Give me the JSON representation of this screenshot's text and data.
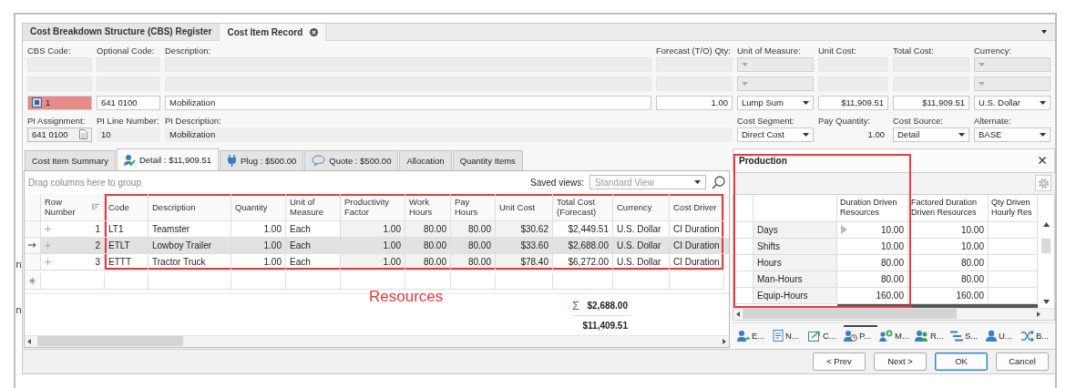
{
  "background_text": [
    "n",
    "n"
  ],
  "document_tabs": [
    {
      "label": "Cost Breakdown Structure (CBS) Register",
      "selected": false,
      "closable": false
    },
    {
      "label": "Cost Item Record",
      "selected": true,
      "closable": true
    }
  ],
  "header_fields": [
    {
      "label": "CBS Code:",
      "kind": "code",
      "value": "1",
      "invalid": true
    },
    {
      "label": "Optional Code:",
      "kind": "text",
      "value": "641 0100"
    },
    {
      "label": "Description:",
      "kind": "text",
      "value": "Mobilization"
    },
    {
      "label": "Forecast (T/O) Qty:",
      "kind": "number",
      "value": "1.00"
    },
    {
      "label": "Unit of Measure:",
      "kind": "dropdown",
      "value": "Lump Sum"
    },
    {
      "label": "Unit Cost:",
      "kind": "number",
      "value": "$11,909.51"
    },
    {
      "label": "Total Cost:",
      "kind": "number",
      "value": "$11,909.51"
    },
    {
      "label": "Currency:",
      "kind": "dropdown",
      "value": "U.S. Dollar"
    }
  ],
  "detail_fields": [
    {
      "label": "PI Assignment:",
      "kind": "lookup",
      "value": "641 0100"
    },
    {
      "label": "PI Line Number:",
      "kind": "readonly",
      "value": "10"
    },
    {
      "label": "PI Description:",
      "kind": "readonly_wide",
      "value": "Mobilization"
    },
    {
      "label": "Cost Segment:",
      "kind": "dropdown",
      "value": "Direct Cost"
    },
    {
      "label": "Pay Quantity:",
      "kind": "plain",
      "value": "1.00"
    },
    {
      "label": "Cost Source:",
      "kind": "dropdown",
      "value": "Detail"
    },
    {
      "label": "Alternate:",
      "kind": "dropdown",
      "value": "BASE"
    }
  ],
  "detail_tabs": [
    {
      "label": "Cost Item Summary",
      "kind": "plain",
      "selected": false
    },
    {
      "label": "Detail : $11,909.51",
      "kind": "detail",
      "selected": true
    },
    {
      "label": "Plug : $500.00",
      "kind": "plug",
      "selected": false
    },
    {
      "label": "Quote : $500.00",
      "kind": "quote",
      "selected": false
    },
    {
      "label": "Allocation",
      "kind": "plain",
      "selected": false
    },
    {
      "label": "Quantity Items",
      "kind": "plain",
      "selected": false
    }
  ],
  "detail_grid": {
    "group_hint": "Drag columns here to group",
    "saved_views_label": "Saved views:",
    "saved_views_placeholder": "Standard View",
    "columns": [
      "Row Number",
      "Code",
      "Description",
      "Quantity",
      "Unit of Measure",
      "Productivity Factor",
      "Work Hours",
      "Pay Hours",
      "Unit Cost",
      "Total Cost (Forecast)",
      "Currency",
      "Cost Driver"
    ],
    "rows": [
      {
        "selected": false,
        "cells": [
          "1",
          "LT1",
          "Teamster",
          "1.00",
          "Each",
          "1.00",
          "80.00",
          "80.00",
          "$30.62",
          "$2,449.51",
          "U.S. Dollar",
          "CI Duration"
        ]
      },
      {
        "selected": true,
        "cells": [
          "2",
          "ETLT",
          "Lowboy Trailer",
          "1.00",
          "Each",
          "1.00",
          "80.00",
          "80.00",
          "$33.60",
          "$2,688.00",
          "U.S. Dollar",
          "CI Duration"
        ]
      },
      {
        "selected": false,
        "cells": [
          "3",
          "ETTT",
          "Tractor Truck",
          "1.00",
          "Each",
          "1.00",
          "80.00",
          "80.00",
          "$78.40",
          "$6,272.00",
          "U.S. Dollar",
          "CI Duration"
        ]
      }
    ],
    "sum_symbol": "Σ",
    "sum": "$2,688.00",
    "total": "$11,409.51",
    "annotation": {
      "outlined": true,
      "label": "Resources"
    }
  },
  "production": {
    "title": "Production",
    "columns": [
      "Duration Driven Resources",
      "Factored Duration Driven Resources",
      "Qty Driven Hourly Res"
    ],
    "rows": [
      {
        "label": "Days",
        "values": [
          "10.00",
          "10.00"
        ],
        "selected": true
      },
      {
        "label": "Shifts",
        "values": [
          "10.00",
          "10.00"
        ],
        "selected": false
      },
      {
        "label": "Hours",
        "values": [
          "80.00",
          "80.00"
        ],
        "selected": false
      },
      {
        "label": "Man-Hours",
        "values": [
          "80.00",
          "80.00"
        ],
        "selected": false
      },
      {
        "label": "Equip-Hours",
        "values": [
          "160.00",
          "160.00"
        ],
        "selected": false
      }
    ],
    "annotation": {
      "outlined": true
    }
  },
  "panel_tabs": [
    {
      "label": "E...",
      "kind": "estimate",
      "selected": false
    },
    {
      "label": "N...",
      "kind": "notes",
      "selected": false
    },
    {
      "label": "C...",
      "kind": "copy",
      "selected": false
    },
    {
      "label": "P...",
      "kind": "production",
      "selected": true
    },
    {
      "label": "M...",
      "kind": "manpower",
      "selected": false
    },
    {
      "label": "R...",
      "kind": "resources",
      "selected": false
    },
    {
      "label": "S...",
      "kind": "schedule",
      "selected": false
    },
    {
      "label": "U...",
      "kind": "user",
      "selected": false
    },
    {
      "label": "B...",
      "kind": "breakdown",
      "selected": false
    }
  ],
  "buttons": [
    {
      "label": "< Prev",
      "default": false
    },
    {
      "label": "Next >",
      "default": false
    },
    {
      "label": "OK",
      "default": true
    },
    {
      "label": "Cancel",
      "default": false
    }
  ]
}
